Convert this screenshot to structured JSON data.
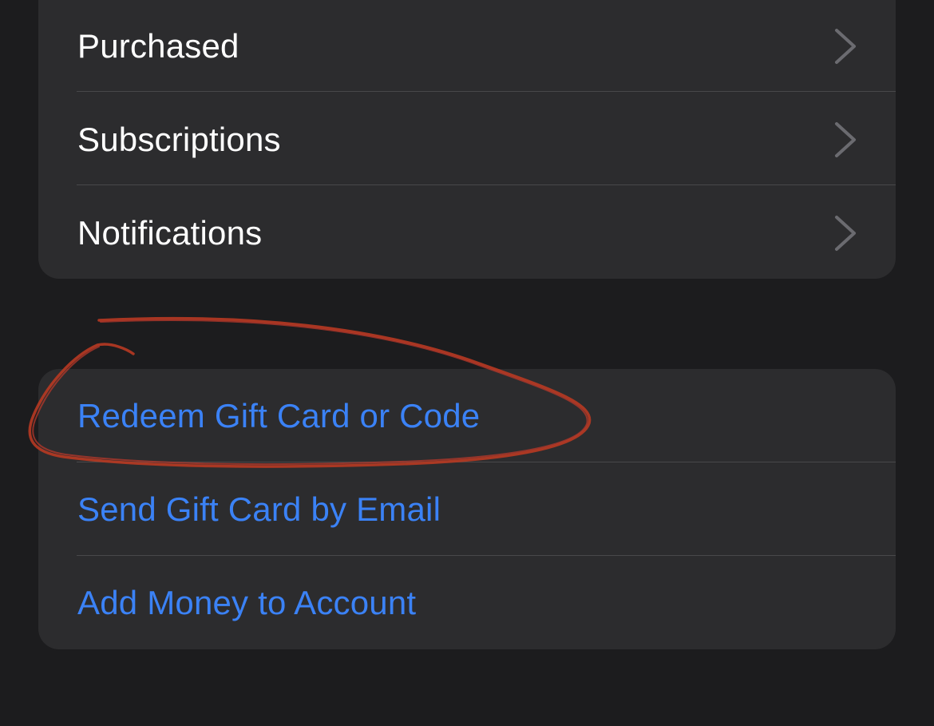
{
  "settings_group": {
    "items": [
      {
        "label": "Purchased",
        "icon": "chevron-right-icon"
      },
      {
        "label": "Subscriptions",
        "icon": "chevron-right-icon"
      },
      {
        "label": "Notifications",
        "icon": "chevron-right-icon"
      }
    ]
  },
  "gift_group": {
    "items": [
      {
        "label": "Redeem Gift Card or Code"
      },
      {
        "label": "Send Gift Card by Email"
      },
      {
        "label": "Add Money to Account"
      }
    ]
  },
  "colors": {
    "background": "#1c1c1e",
    "group_background": "#2c2c2e",
    "separator": "#48484a",
    "link_blue": "#3b82f6",
    "chevron": "#6b6b70",
    "annotation_red": "#c0392b"
  }
}
